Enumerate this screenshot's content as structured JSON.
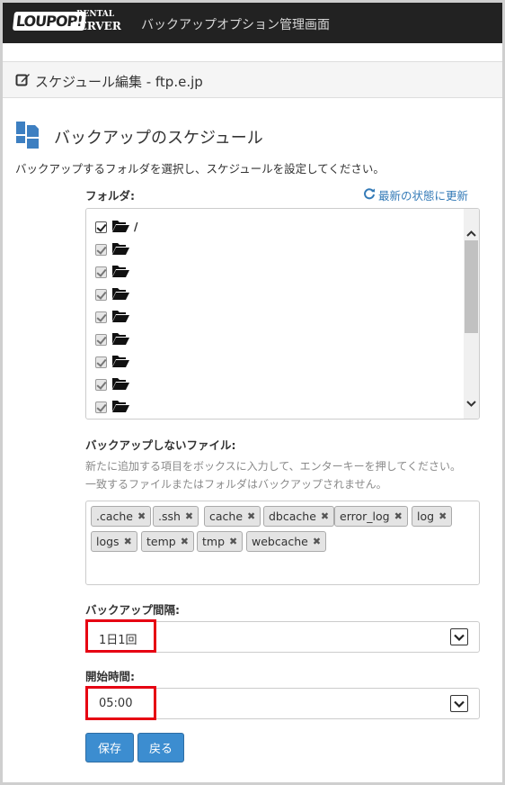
{
  "header": {
    "logo_main": "LOUPOP!",
    "logo_rental": "RENTAL",
    "logo_server": "SERVER",
    "app_title": "バックアップオプション管理画面"
  },
  "subheader": {
    "title": "スケジュール編集 - ftp.e.jp"
  },
  "section": {
    "title": "バックアップのスケジュール",
    "instruction": "バックアップするフォルダを選択し、スケジュールを設定してください。"
  },
  "folders": {
    "label": "フォルダ:",
    "refresh_label": "最新の状態に更新",
    "items": [
      {
        "name": "/",
        "checked": true,
        "disabled": false
      },
      {
        "name": "",
        "checked": true,
        "disabled": true
      },
      {
        "name": "",
        "checked": true,
        "disabled": true
      },
      {
        "name": "",
        "checked": true,
        "disabled": true
      },
      {
        "name": "",
        "checked": true,
        "disabled": true
      },
      {
        "name": "",
        "checked": true,
        "disabled": true
      },
      {
        "name": "",
        "checked": true,
        "disabled": true
      },
      {
        "name": "",
        "checked": true,
        "disabled": true
      },
      {
        "name": "",
        "checked": true,
        "disabled": true
      }
    ]
  },
  "excludes": {
    "label": "バックアップしないファイル:",
    "help_line1": "新たに追加する項目をボックスに入力して、エンターキーを押してください。",
    "help_line2": "一致するファイルまたはフォルダはバックアップされません。",
    "tags": [
      ".cache",
      ".ssh",
      "cache",
      "dbcache",
      "error_log",
      "log",
      "logs",
      "temp",
      "tmp",
      "webcache"
    ],
    "remove_symbol": "✖"
  },
  "interval": {
    "label": "バックアップ間隔:",
    "value": "1日1回"
  },
  "start_time": {
    "label": "開始時間:",
    "value": "05:00"
  },
  "buttons": {
    "save": "保存",
    "back": "戻る"
  },
  "colors": {
    "topbar": "#222222",
    "link": "#337ab7",
    "button": "#3c8dd0",
    "highlight": "#e60012"
  }
}
